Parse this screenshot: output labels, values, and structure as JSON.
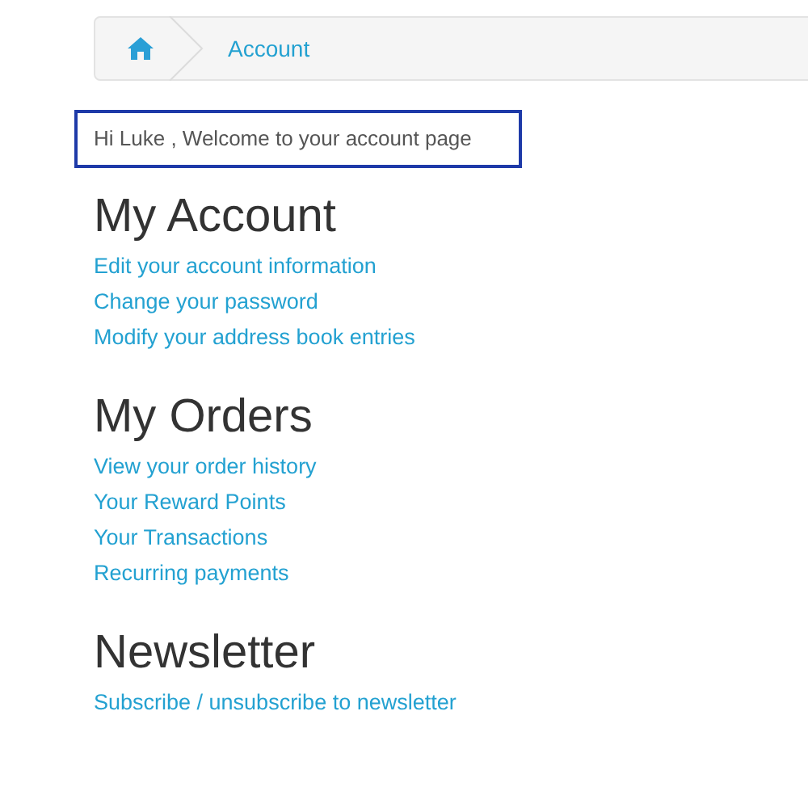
{
  "breadcrumb": [
    {
      "kind": "home"
    },
    {
      "kind": "text",
      "label": "Account"
    }
  ],
  "welcome": "Hi Luke , Welcome to your account page",
  "sections": [
    {
      "title": "My Account",
      "links": [
        "Edit your account information",
        "Change your password",
        "Modify your address book entries"
      ]
    },
    {
      "title": "My Orders",
      "links": [
        "View your order history",
        "Your Reward Points",
        "Your Transactions",
        "Recurring payments"
      ]
    },
    {
      "title": "Newsletter",
      "links": [
        "Subscribe / unsubscribe to newsletter"
      ]
    }
  ]
}
